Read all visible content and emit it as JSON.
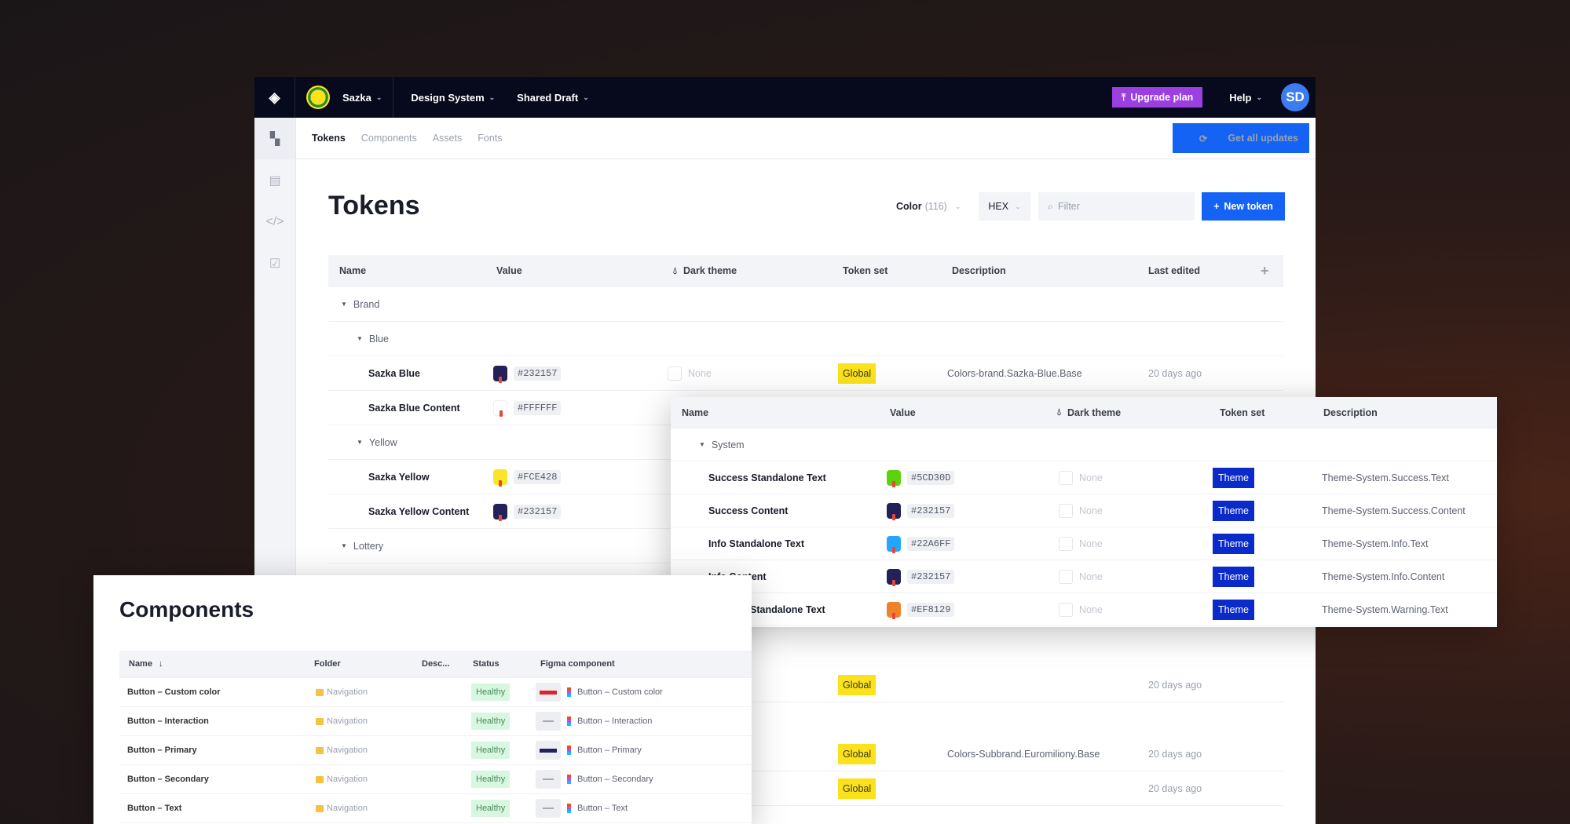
{
  "topbar": {
    "workspace": "Sazka",
    "project": "Design System",
    "branch": "Shared Draft",
    "upgrade": "Upgrade plan",
    "help": "Help",
    "avatar": "SD"
  },
  "subtabs": [
    {
      "label": "Tokens",
      "active": true
    },
    {
      "label": "Components"
    },
    {
      "label": "Assets"
    },
    {
      "label": "Fonts"
    }
  ],
  "get_updates": "Get all updates",
  "page_title": "Tokens",
  "controls": {
    "type": "Color",
    "count": "(116)",
    "format": "HEX",
    "filter_placeholder": "Filter",
    "new_token": "New token"
  },
  "tokens_table": {
    "headers": [
      "Name",
      "Value",
      "Dark theme",
      "Token set",
      "Description",
      "Last edited"
    ],
    "groups": {
      "brand": "Brand",
      "blue": "Blue",
      "yellow": "Yellow",
      "lottery": "Lottery"
    },
    "rows": [
      {
        "name": "Sazka Blue",
        "value": "#232157",
        "color": "#232157",
        "dark": "None",
        "set": "Global",
        "desc": "Colors-brand.Sazka-Blue.Base",
        "edited": "20 days ago"
      },
      {
        "name": "Sazka Blue Content",
        "value": "#FFFFFF",
        "color": "#FFFFFF"
      },
      {
        "name": "Sazka Yellow",
        "value": "#FCE428",
        "color": "#FCE428"
      },
      {
        "name": "Sazka Yellow Content",
        "value": "#232157",
        "color": "#232157"
      }
    ],
    "lower_rows": [
      {
        "set": "Global",
        "desc": "",
        "edited": "20 days ago"
      },
      {
        "set": "Global",
        "desc": "Colors-Subbrand.Euromiliony.Base",
        "edited": "20 days ago"
      },
      {
        "set": "Global",
        "desc": "",
        "edited": "20 days ago"
      }
    ]
  },
  "theme_panel": {
    "headers": [
      "Name",
      "Value",
      "Dark theme",
      "Token set",
      "Description"
    ],
    "group": "System",
    "rows": [
      {
        "name": "Success Standalone Text",
        "value": "#5CD30D",
        "color": "#5CD30D",
        "dark": "None",
        "set": "Theme",
        "desc": "Theme-System.Success.Text"
      },
      {
        "name": "Success Content",
        "value": "#232157",
        "color": "#232157",
        "dark": "None",
        "set": "Theme",
        "desc": "Theme-System.Success.Content"
      },
      {
        "name": "Info Standalone Text",
        "value": "#22A6FF",
        "color": "#22A6FF",
        "dark": "None",
        "set": "Theme",
        "desc": "Theme-System.Info.Text"
      },
      {
        "name": "Info Content",
        "value": "#232157",
        "color": "#232157",
        "dark": "None",
        "set": "Theme",
        "desc": "Theme-System.Info.Content"
      },
      {
        "name": "Warning Standalone Text",
        "value": "#EF8129",
        "color": "#EF8129",
        "dark": "None",
        "set": "Theme",
        "desc": "Theme-System.Warning.Text"
      }
    ]
  },
  "components_panel": {
    "title": "Components",
    "headers": [
      "Name",
      "Folder",
      "Desc...",
      "Status",
      "Figma component"
    ],
    "rows": [
      {
        "name": "Button – Custom color",
        "folder": "Navigation",
        "status": "Healthy",
        "figma": "Button – Custom color",
        "thumb": "#d8262e"
      },
      {
        "name": "Button – Interaction",
        "folder": "Navigation",
        "status": "Healthy",
        "figma": "Button – Interaction",
        "thumb": ""
      },
      {
        "name": "Button – Primary",
        "folder": "Navigation",
        "status": "Healthy",
        "figma": "Button – Primary",
        "thumb": "#232157"
      },
      {
        "name": "Button – Secondary",
        "folder": "Navigation",
        "status": "Healthy",
        "figma": "Button – Secondary",
        "thumb": ""
      },
      {
        "name": "Button – Text",
        "folder": "Navigation",
        "status": "Healthy",
        "figma": "Button – Text",
        "thumb": ""
      }
    ]
  }
}
